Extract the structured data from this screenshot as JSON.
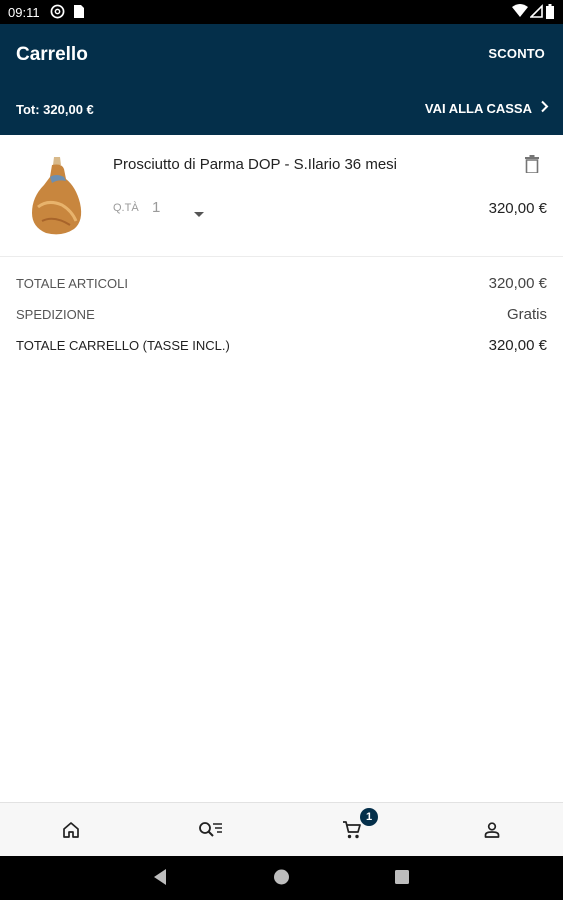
{
  "status_bar": {
    "time": "09:11",
    "icons": [
      "at-sign-icon",
      "sim-card-icon",
      "wifi-icon",
      "signal-icon",
      "battery-icon"
    ]
  },
  "app_bar": {
    "title": "Carrello",
    "discount_label": "SCONTO",
    "total_summary": "Tot: 320,00 €",
    "checkout_label": "VAI ALLA CASSA",
    "background_color": "#042f4a"
  },
  "cart": {
    "items": [
      {
        "name": "Prosciutto di Parma DOP - S.Ilario 36 mesi",
        "qty_label": "Q.TÀ",
        "qty": "1",
        "price": "320,00 €",
        "image_icon": "prosciutto-ham-image"
      }
    ]
  },
  "summary": {
    "items_total_label": "TOTALE ARTICOLI",
    "items_total_value": "320,00 €",
    "shipping_label": "SPEDIZIONE",
    "shipping_value": "Gratis",
    "cart_total_label": "TOTALE CARRELLO (TASSE INCL.)",
    "cart_total_value": "320,00 €"
  },
  "bottom_nav": {
    "items": [
      {
        "icon": "home-icon"
      },
      {
        "icon": "search-list-icon"
      },
      {
        "icon": "cart-icon",
        "badge": "1"
      },
      {
        "icon": "account-icon"
      }
    ]
  },
  "system_nav": {
    "icons": [
      "back-icon",
      "home-circle-icon",
      "recents-icon"
    ]
  }
}
